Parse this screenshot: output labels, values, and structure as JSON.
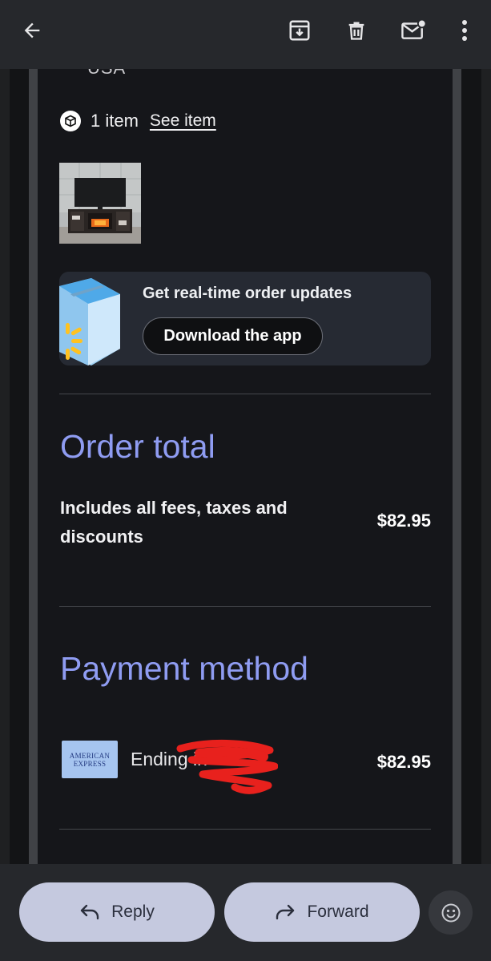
{
  "toolbar": {
    "back_icon": "arrow-left-icon",
    "archive_icon": "archive-icon",
    "delete_icon": "trash-icon",
    "mark_unread_icon": "mail-unread-icon",
    "more_icon": "more-vert-icon"
  },
  "email": {
    "address_cutoff": "USA",
    "item_count": "1 item",
    "see_item_link": "See item",
    "promo": {
      "text": "Get real-time order updates",
      "button": "Download the app"
    },
    "order_total": {
      "heading": "Order total",
      "label": "Includes all fees, taxes and discounts",
      "amount": "$82.95"
    },
    "payment": {
      "heading": "Payment method",
      "card_brand_line1": "AMERICAN",
      "card_brand_line2": "EXPRESS",
      "card_text": "Ending in",
      "amount": "$82.95"
    }
  },
  "bottom": {
    "reply": "Reply",
    "forward": "Forward",
    "emoji_icon": "emoji-reaction-icon"
  },
  "colors": {
    "heading_accent": "#8f9cf2",
    "pill_bg": "#c5c9df",
    "background": "#15161a"
  }
}
